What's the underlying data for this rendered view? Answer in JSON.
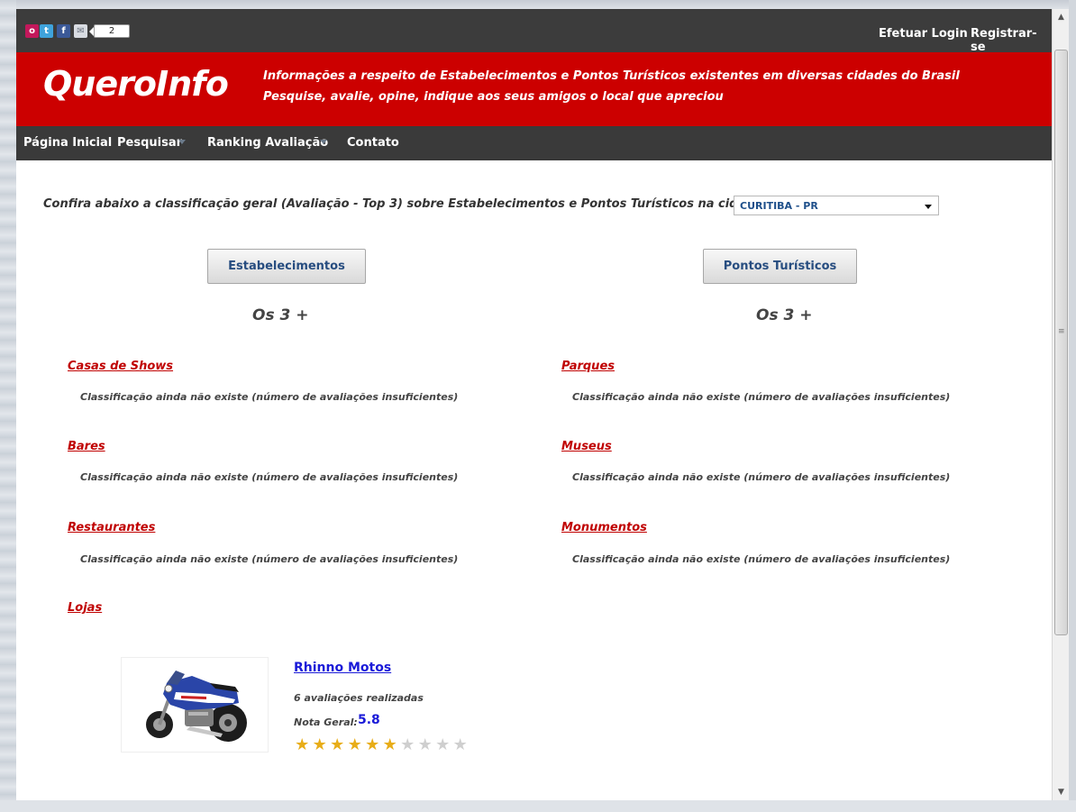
{
  "topbar": {
    "share_count": "2",
    "login_label": "Efetuar Login",
    "register_label": "Registrar-se",
    "social_icons": [
      "orkut-icon",
      "twitter-icon",
      "facebook-icon",
      "email-icon"
    ],
    "social_glyphs": {
      "orkut": "o",
      "twitter": "t",
      "facebook": "f",
      "email": "✉"
    }
  },
  "banner": {
    "logo": "QueroInfo",
    "tagline_1": "Informações a respeito de Estabelecimentos e Pontos Turísticos existentes em diversas cidades do Brasil",
    "tagline_2": "Pesquise, avalie, opine, indique aos seus amigos o local que apreciou"
  },
  "nav": {
    "home": "Página Inicial",
    "search": "Pesquisar",
    "ranking": "Ranking Avaliação",
    "contact": "Contato"
  },
  "main": {
    "intro": "Confira abaixo a classificação geral (Avaliação - Top 3) sobre Estabelecimentos e Pontos Turísticos na cidade de",
    "city_selected": "CURITIBA - PR",
    "btn_establishments": "Estabelecimentos",
    "btn_tourist": "Pontos Turísticos",
    "heading_left": "Os 3 +",
    "heading_right": "Os 3 +",
    "empty_msg": "Classificação ainda não existe (número de avaliações insuficientes)",
    "categories_left": [
      "Casas de Shows",
      "Bares",
      "Restaurantes",
      "Lojas"
    ],
    "categories_right": [
      "Parques",
      "Museus",
      "Monumentos"
    ]
  },
  "store": {
    "name": "Rhinno Motos",
    "reviews": "6 avaliações realizadas",
    "grade_label": "Nota Geral:",
    "grade_value": "5.8",
    "rating_filled": 6,
    "rating_total": 10
  },
  "colors": {
    "brand_red": "#cc0000",
    "topbar": "#3c3c3c",
    "link_blue": "#1a1ad8",
    "star_on": "#e8ad18",
    "star_off": "#cfcfcf"
  }
}
